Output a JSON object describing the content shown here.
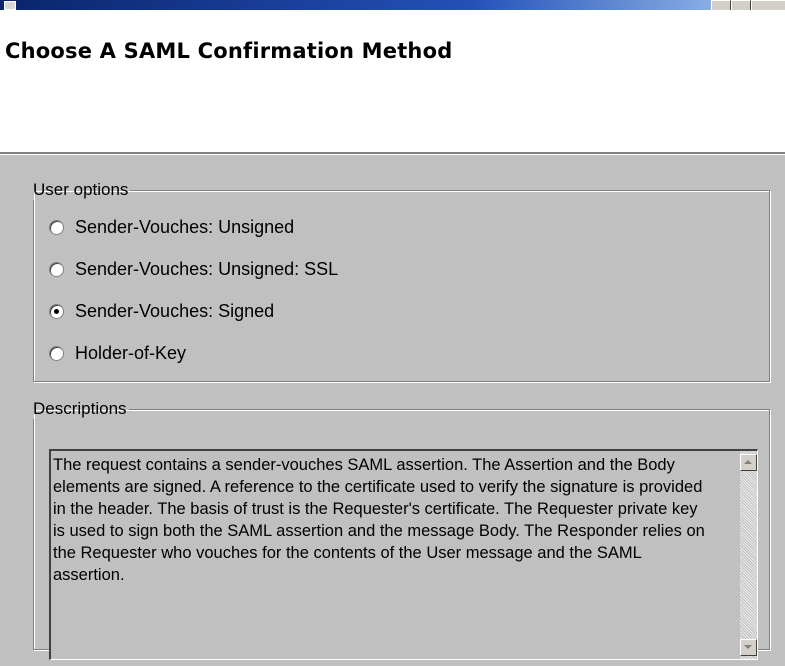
{
  "header": {
    "title": "Choose A SAML Confirmation Method"
  },
  "user_options": {
    "legend": "User options",
    "options": [
      {
        "label": "Sender-Vouches: Unsigned",
        "selected": false
      },
      {
        "label": "Sender-Vouches: Unsigned: SSL",
        "selected": false
      },
      {
        "label": "Sender-Vouches: Signed",
        "selected": true
      },
      {
        "label": "Holder-of-Key",
        "selected": false
      }
    ]
  },
  "descriptions": {
    "legend": "Descriptions",
    "text": "The request contains a sender-vouches SAML assertion.  The Assertion and the Body elements are signed. A reference to the certificate used to verify the signature is provided in the header. The basis of trust is the Requester's certificate. The Requester private key is used to sign both the SAML assertion and the message Body. The Responder relies on the Requester who vouches for the contents of the User message and the SAML assertion."
  }
}
